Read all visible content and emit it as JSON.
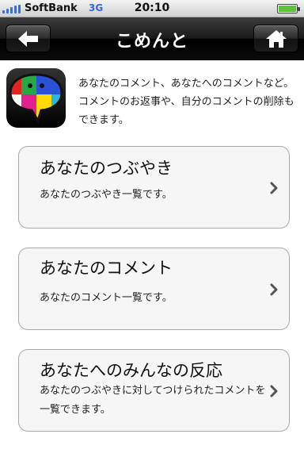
{
  "status_bar": {
    "carrier": "SoftBank",
    "network": "3G",
    "time": "20:10"
  },
  "nav": {
    "title": "こめんと",
    "back_icon": "back-arrow-icon",
    "home_icon": "home-icon"
  },
  "intro": {
    "text": "あなたのコメント、あなたへのコメントなど。コメントのお返事や、自分のコメントの削除もできます。"
  },
  "menu": [
    {
      "title": "あなたのつぶやき",
      "description": "あなたのつぶやき一覧です。"
    },
    {
      "title": "あなたのコメント",
      "description": "あなたのコメント一覧です。"
    },
    {
      "title": "あなたへのみんなの反応",
      "description": "あなたのつぶやきに対してつけられたコメントを一覧できます。"
    }
  ],
  "colors": {
    "nav_background": "#000000",
    "card_background": "#f6f6f6",
    "card_border": "#a8a8a8",
    "network_label": "#2f6ad8",
    "battery": "#5ec437"
  }
}
